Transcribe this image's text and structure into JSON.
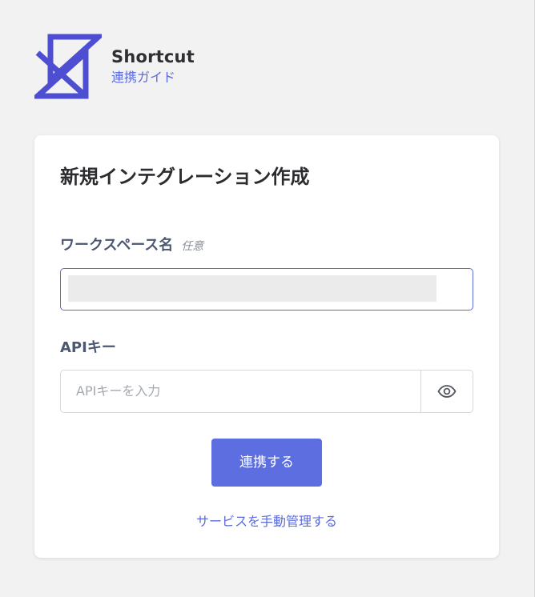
{
  "brand": {
    "logo_icon": "shortcut-logo-icon",
    "name": "Shortcut",
    "guide_link": "連携ガイド",
    "accent_color": "#4d4ed1"
  },
  "form": {
    "title": "新規インテグレーション作成",
    "workspace": {
      "label": "ワークスペース名",
      "optional": "任意",
      "value": ""
    },
    "apikey": {
      "label": "APIキー",
      "placeholder": "APIキーを入力",
      "toggle_icon": "eye-icon"
    },
    "submit_label": "連携する",
    "manual_link": "サービスを手動管理する"
  },
  "colors": {
    "primary": "#5c6ee0",
    "link": "#5b6bd9",
    "background": "#f2f2f2"
  }
}
